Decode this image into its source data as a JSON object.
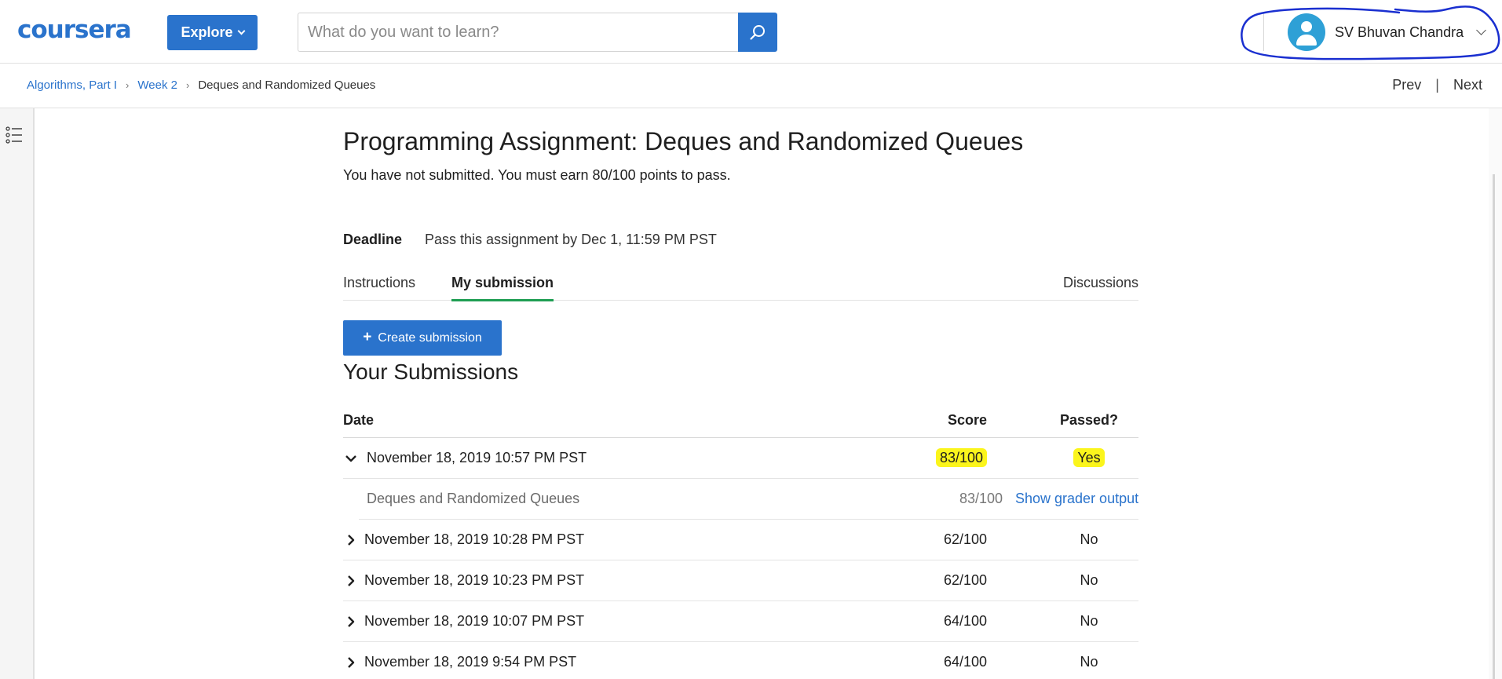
{
  "header": {
    "logo_text": "coursera",
    "explore_label": "Explore",
    "search_placeholder": "What do you want to learn?",
    "user_name": "SV Bhuvan Chandra"
  },
  "breadcrumb": {
    "items": [
      "Algorithms, Part I",
      "Week 2"
    ],
    "current": "Deques and Randomized Queues"
  },
  "nav": {
    "prev": "Prev",
    "next": "Next",
    "separator": "|"
  },
  "assignment": {
    "title": "Programming Assignment: Deques and Randomized Queues",
    "status": "You have not submitted. You must earn 80/100 points to pass.",
    "deadline_label": "Deadline",
    "deadline_value": "Pass this assignment by Dec 1, 11:59 PM PST"
  },
  "tabs": {
    "instructions": "Instructions",
    "my_submission": "My submission",
    "discussions": "Discussions"
  },
  "create_submission_label": "Create submission",
  "submissions": {
    "title": "Your Submissions",
    "columns": {
      "date": "Date",
      "score": "Score",
      "passed": "Passed?"
    },
    "rows": [
      {
        "date": "November 18, 2019 10:57 PM PST",
        "score": "83/100",
        "passed": "Yes",
        "expanded": true
      },
      {
        "date": "November 18, 2019 10:28 PM PST",
        "score": "62/100",
        "passed": "No",
        "expanded": false
      },
      {
        "date": "November 18, 2019 10:23 PM PST",
        "score": "62/100",
        "passed": "No",
        "expanded": false
      },
      {
        "date": "November 18, 2019 10:07 PM PST",
        "score": "64/100",
        "passed": "No",
        "expanded": false
      },
      {
        "date": "November 18, 2019 9:54 PM PST",
        "score": "64/100",
        "passed": "No",
        "expanded": false
      }
    ],
    "expanded_detail": {
      "part_name": "Deques and Randomized Queues",
      "score": "83/100",
      "action": "Show grader output"
    }
  },
  "colors": {
    "brand_blue": "#2a73cc",
    "tab_underline": "#1f9e53",
    "highlight_yellow": "#fbf51c",
    "annotation_ink": "#1a2fd0"
  }
}
